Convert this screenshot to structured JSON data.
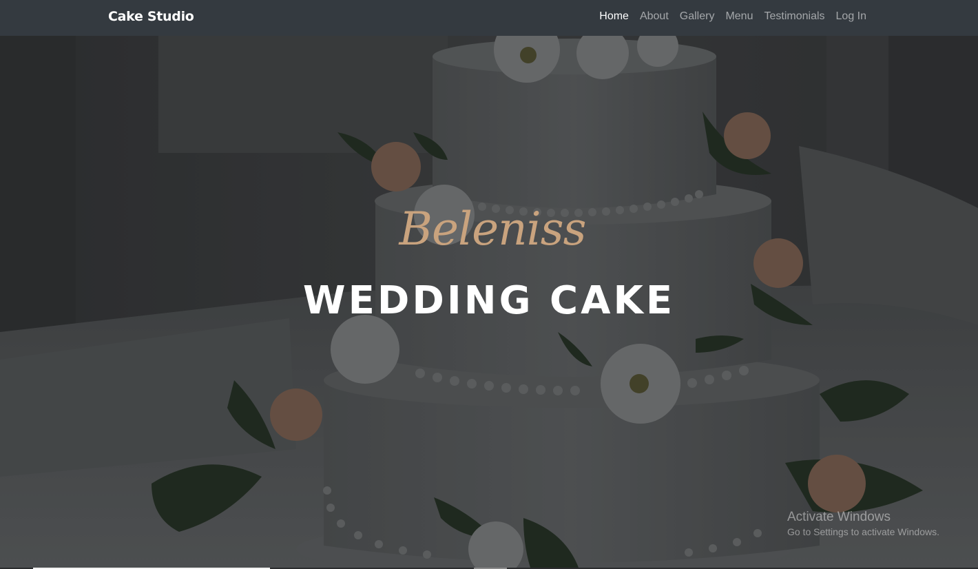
{
  "navbar": {
    "brand": "Cake Studio",
    "links": [
      {
        "label": "Home",
        "active": true
      },
      {
        "label": "About"
      },
      {
        "label": "Gallery"
      },
      {
        "label": "Menu"
      },
      {
        "label": "Testimonials"
      },
      {
        "label": "Log In"
      }
    ]
  },
  "hero": {
    "script_title": "Beleniss",
    "main_title": "WEDDING CAKE",
    "background": "wedding-cake-photo",
    "overlay_color": "#000000"
  },
  "watermark": {
    "title": "Activate Windows",
    "subtitle": "Go to Settings to activate Windows."
  },
  "colors": {
    "navbar_bg": "#343a40",
    "script_accent": "#c9a37e",
    "heading": "#ffffff"
  }
}
